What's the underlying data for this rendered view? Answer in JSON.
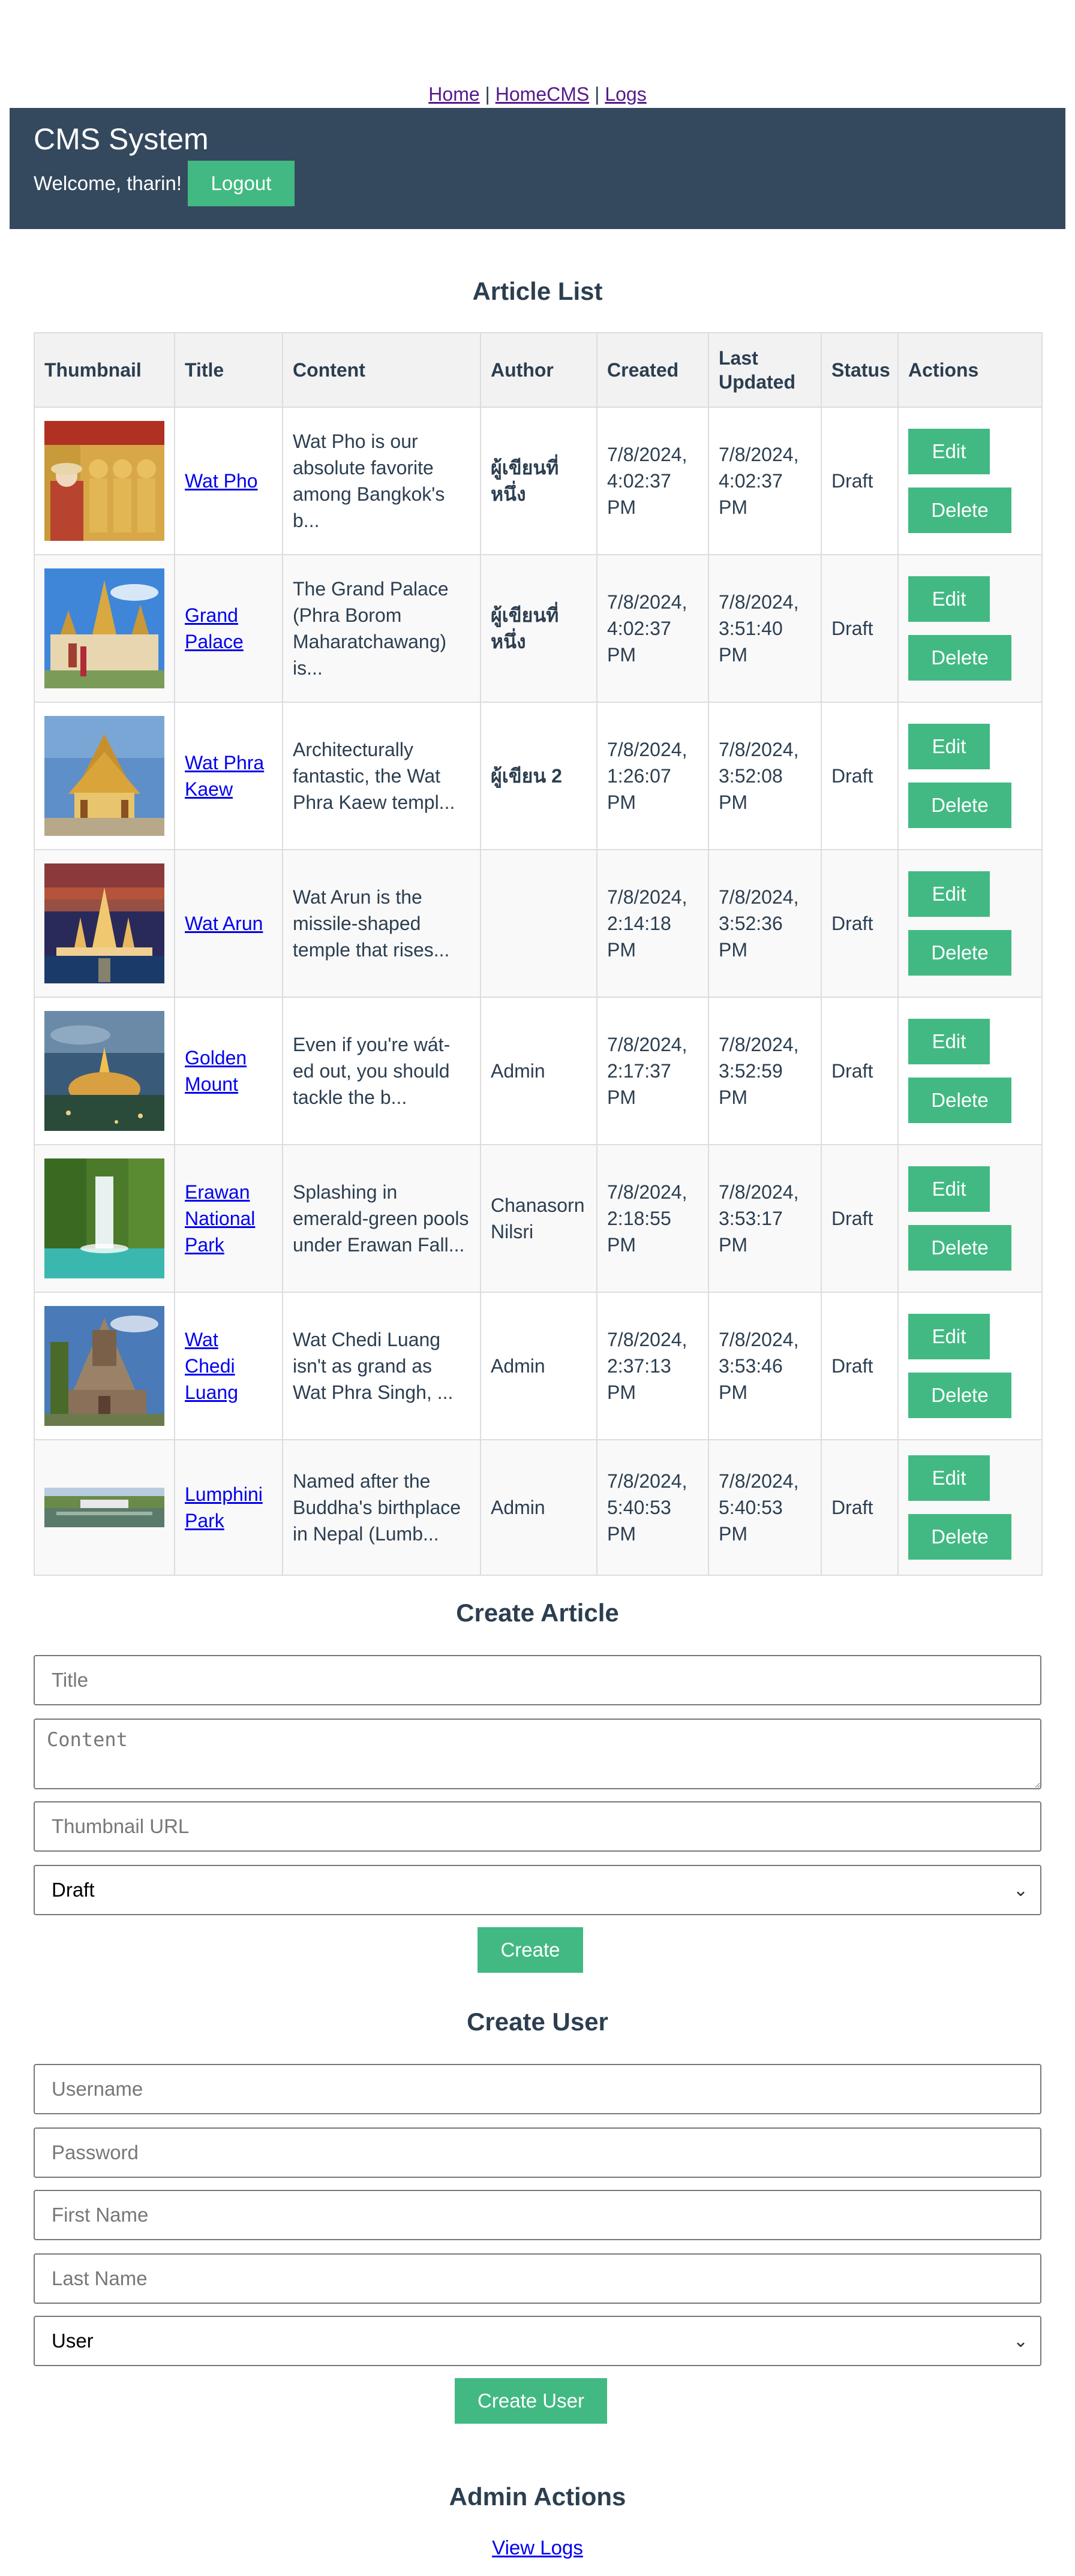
{
  "nav": {
    "links": [
      "Home",
      "HomeCMS",
      "Logs"
    ],
    "separator": "|"
  },
  "header": {
    "title": "CMS System",
    "welcome": "Welcome, tharin!",
    "logout_label": "Logout"
  },
  "article_list": {
    "title": "Article List",
    "columns": [
      "Thumbnail",
      "Title",
      "Content",
      "Author",
      "Created",
      "Last Updated",
      "Status",
      "Actions"
    ],
    "rows": [
      {
        "title": "Wat Pho",
        "content": "Wat Pho is our absolute favorite among Bangkok's b...",
        "author": "ผู้เขียนที่หนึ่ง",
        "created": "7/8/2024, 4:02:37 PM",
        "updated": "7/8/2024, 4:02:37 PM",
        "status": "Draft"
      },
      {
        "title": "Grand Palace",
        "content": "The Grand Palace (Phra Borom Maharatchawang) is...",
        "author": "ผู้เขียนที่หนึ่ง",
        "created": "7/8/2024, 4:02:37 PM",
        "updated": "7/8/2024, 3:51:40 PM",
        "status": "Draft"
      },
      {
        "title": "Wat Phra Kaew",
        "content": "Architecturally fantastic, the Wat Phra Kaew templ...",
        "author": "ผู้เขียน 2",
        "created": "7/8/2024, 1:26:07 PM",
        "updated": "7/8/2024, 3:52:08 PM",
        "status": "Draft"
      },
      {
        "title": "Wat Arun",
        "content": "Wat Arun is the missile-shaped temple that rises...",
        "author": "",
        "created": "7/8/2024, 2:14:18 PM",
        "updated": "7/8/2024, 3:52:36 PM",
        "status": "Draft"
      },
      {
        "title": "Golden Mount",
        "content": "Even if you're wát-ed out, you should tackle the b...",
        "author": "Admin",
        "created": "7/8/2024, 2:17:37 PM",
        "updated": "7/8/2024, 3:52:59 PM",
        "status": "Draft"
      },
      {
        "title": "Erawan National Park",
        "content": "Splashing in emerald-green pools under Erawan Fall...",
        "author": "Chanasorn Nilsri",
        "created": "7/8/2024, 2:18:55 PM",
        "updated": "7/8/2024, 3:53:17 PM",
        "status": "Draft"
      },
      {
        "title": "Wat Chedi Luang",
        "content": "Wat Chedi Luang isn't as grand as Wat Phra Singh, ...",
        "author": "Admin",
        "created": "7/8/2024, 2:37:13 PM",
        "updated": "7/8/2024, 3:53:46 PM",
        "status": "Draft"
      },
      {
        "title": "Lumphini Park",
        "content": "Named after the Buddha's birthplace in Nepal (Lumb...",
        "author": "Admin",
        "created": "7/8/2024, 5:40:53 PM",
        "updated": "7/8/2024, 5:40:53 PM",
        "status": "Draft"
      }
    ],
    "edit_label": "Edit",
    "delete_label": "Delete"
  },
  "create_article": {
    "title": "Create Article",
    "title_placeholder": "Title",
    "content_placeholder": "Content",
    "thumbnail_placeholder": "Thumbnail URL",
    "status_selected": "Draft",
    "submit_label": "Create"
  },
  "create_user": {
    "title": "Create User",
    "username_placeholder": "Username",
    "password_placeholder": "Password",
    "firstname_placeholder": "First Name",
    "lastname_placeholder": "Last Name",
    "role_selected": "User",
    "submit_label": "Create User"
  },
  "admin_actions": {
    "title": "Admin Actions",
    "view_logs_label": "View Logs"
  },
  "colors": {
    "header_bg": "#34495e",
    "accent": "#42b983",
    "text": "#2c3e50",
    "link": "#0000ee"
  }
}
